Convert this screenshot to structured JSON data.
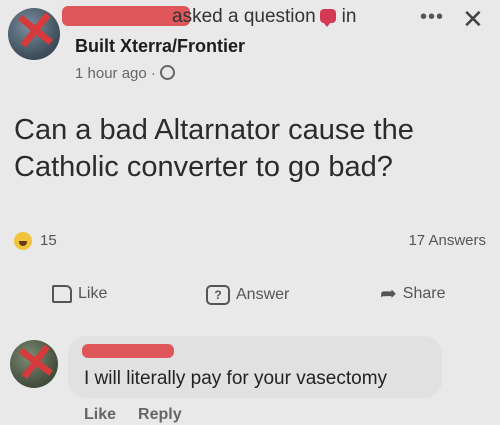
{
  "post": {
    "header_text": "asked a question",
    "header_in": "in",
    "group_name": "Built Xterra/Frontier",
    "time": "1 hour ago ·",
    "question": "Can a bad Altarnator cause the Catholic converter to go bad?"
  },
  "stats": {
    "reactions": "15",
    "answers": "17 Answers"
  },
  "actions": {
    "like": "Like",
    "answer": "Answer",
    "share": "Share"
  },
  "comment": {
    "text": "I will literally pay for your vasectomy",
    "like": "Like",
    "reply": "Reply"
  },
  "icons": {
    "more": "more-icon",
    "close": "close-icon",
    "globe": "globe-icon",
    "emoji": "emoji-icon"
  },
  "colors": {
    "redaction": "#e0575b",
    "question_badge": "#d23a55",
    "background": "#e9e9e9"
  }
}
